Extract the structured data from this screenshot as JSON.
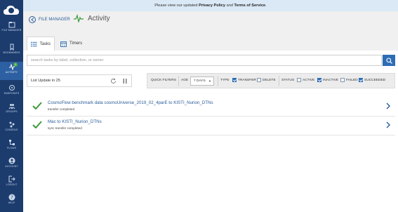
{
  "notice": {
    "prefix": "Please view our updated ",
    "link1": "Privacy Policy",
    "mid": " and ",
    "link2": "Terms of Service",
    "suffix": "."
  },
  "sidebar": {
    "items": [
      {
        "label": "FILE MANAGER",
        "icon": "file-manager-icon"
      },
      {
        "label": "BOOKMARKS",
        "icon": "bookmark-icon"
      },
      {
        "label": "ACTIVITY",
        "icon": "activity-icon",
        "badge": "1",
        "active": true
      },
      {
        "label": "ENDPOINTS",
        "icon": "endpoints-icon"
      },
      {
        "label": "GROUPS",
        "icon": "groups-icon"
      },
      {
        "label": "CONSOLE",
        "icon": "console-icon"
      },
      {
        "label": "FLOWS",
        "icon": "flows-icon"
      },
      {
        "label": "ACCOUNT",
        "icon": "account-icon"
      },
      {
        "label": "LOGOUT",
        "icon": "logout-icon"
      },
      {
        "label": "HELP",
        "icon": "help-icon"
      }
    ]
  },
  "header": {
    "back_label": "FILE MANAGER",
    "title": "Activity"
  },
  "tabs": [
    {
      "label": "Tasks",
      "active": true
    },
    {
      "label": "Timers",
      "active": false
    }
  ],
  "search": {
    "placeholder": "search tasks by label, collection, or owner",
    "value": ""
  },
  "list_update": {
    "label": "List Update in 25"
  },
  "filters": {
    "quick_label": "QUICK FILTERS",
    "age_label": "AGE",
    "age_value": "7 DAYS",
    "type_label": "TYPE",
    "types": [
      {
        "label": "TRANSFER",
        "checked": true
      },
      {
        "label": "DELETE",
        "checked": false
      }
    ],
    "status_label": "STATUS",
    "statuses": [
      {
        "label": "ACTIVE",
        "checked": false
      },
      {
        "label": "INACTIVE",
        "checked": true
      },
      {
        "label": "FAILED",
        "checked": false
      },
      {
        "label": "SUCCEEDED",
        "checked": true
      }
    ]
  },
  "tasks": [
    {
      "name": "CosmoFlow benchmark data cosmoUniverse_2019_02_4parE to KISTI_Nurion_DTNs",
      "status": "transfer completed"
    },
    {
      "name": "Mac to KISTI_Nurion_DTNs",
      "status": "sync transfer completed"
    }
  ],
  "colors": {
    "sidebar": "#1c3c6e",
    "sidebar_active": "#2d5fa3",
    "accent": "#2d6db5",
    "success": "#3c9a3c",
    "notice_bg": "#dbe9f6"
  }
}
